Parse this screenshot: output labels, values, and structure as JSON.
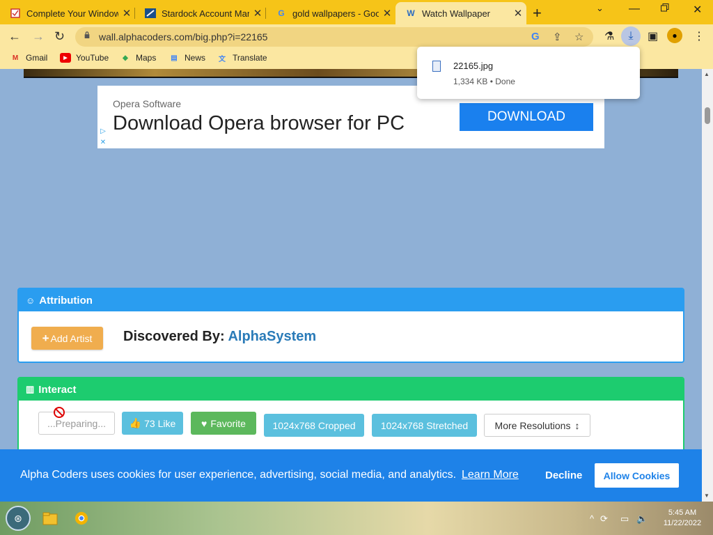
{
  "tabs": [
    {
      "title": "Complete Your Window",
      "favicon": "checkbox-icon"
    },
    {
      "title": "Stardock Account Man",
      "favicon": "stardock-icon"
    },
    {
      "title": "gold wallpapers - Goo",
      "favicon": "google-icon"
    },
    {
      "title": "Watch Wallpaper",
      "favicon": "alphacoders-icon",
      "active": true
    }
  ],
  "address": {
    "url": "wall.alphacoders.com/big.php?i=22165"
  },
  "bookmarks": [
    {
      "label": "Gmail",
      "icon": "gmail-icon"
    },
    {
      "label": "YouTube",
      "icon": "youtube-icon"
    },
    {
      "label": "Maps",
      "icon": "maps-icon"
    },
    {
      "label": "News",
      "icon": "news-icon"
    },
    {
      "label": "Translate",
      "icon": "translate-icon"
    }
  ],
  "download": {
    "filename": "22165.jpg",
    "status": "1,334 KB • Done"
  },
  "ad": {
    "source": "Opera Software",
    "headline": "Download Opera browser for PC",
    "button": "DOWNLOAD"
  },
  "attribution": {
    "title": "Attribution",
    "add_artist": "Add Artist",
    "discovered_label": "Discovered By:",
    "discovered_by": "AlphaSystem"
  },
  "interact": {
    "title": "Interact",
    "preparing": "...Preparing...",
    "like": "73 Like",
    "favorite": "Favorite",
    "cropped": "1024x768 Cropped",
    "stretched": "1024x768 Stretched",
    "more": "More Resolutions"
  },
  "cookie": {
    "text": "Alpha Coders uses cookies for user experience, advertising, social media, and analytics.",
    "learn_more": "Learn More",
    "decline": "Decline",
    "allow": "Allow Cookies"
  },
  "taskbar": {
    "time": "5:45 AM",
    "date": "11/22/2022"
  },
  "colors": {
    "chrome_frame": "#f6c418",
    "attribution": "#2a9df0",
    "interact": "#1dcc6f",
    "cookie_banner": "#1e82e8"
  }
}
